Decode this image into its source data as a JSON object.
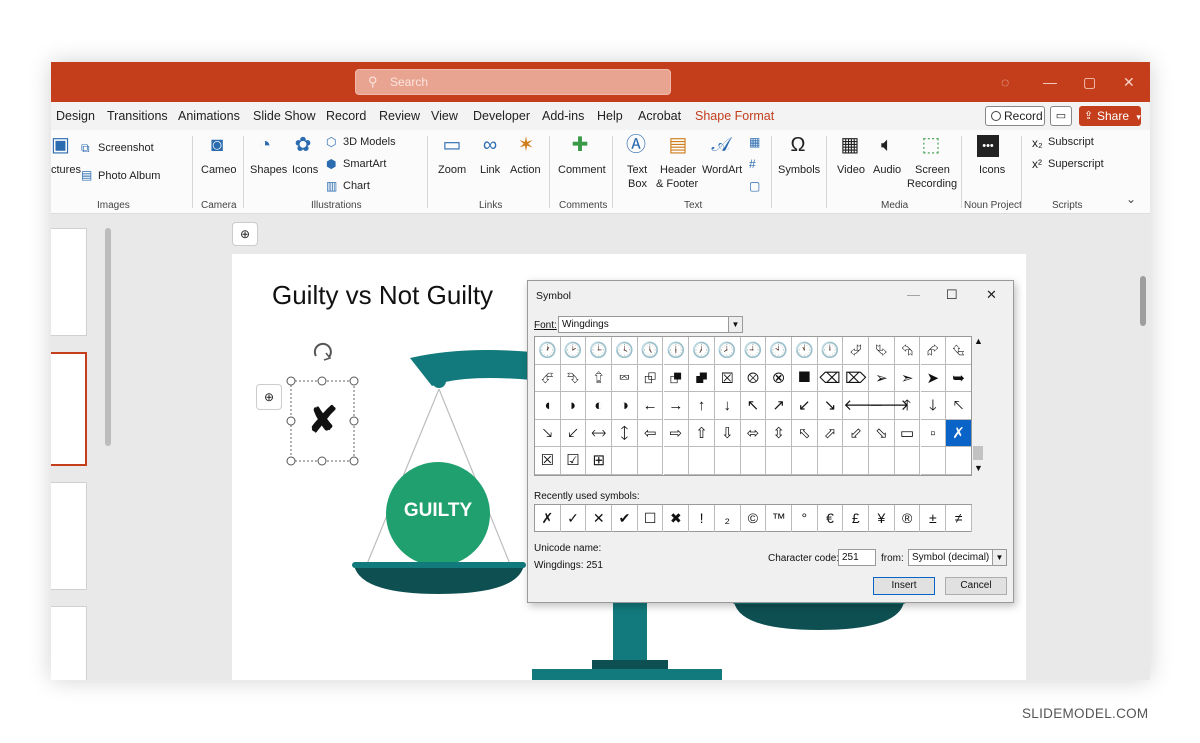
{
  "titlebar": {
    "search_placeholder": "Search"
  },
  "tabs": [
    {
      "label": "Design"
    },
    {
      "label": "Transitions"
    },
    {
      "label": "Animations"
    },
    {
      "label": "Slide Show"
    },
    {
      "label": "Record"
    },
    {
      "label": "Review"
    },
    {
      "label": "View"
    },
    {
      "label": "Developer"
    },
    {
      "label": "Add-ins"
    },
    {
      "label": "Help"
    },
    {
      "label": "Acrobat"
    },
    {
      "label": "Shape Format"
    }
  ],
  "tab_buttons": {
    "record": "Record",
    "share": "Share"
  },
  "ribbon": {
    "images": {
      "pictures": "ctures",
      "screenshot": "Screenshot",
      "photo_album": "Photo Album",
      "label": "Images"
    },
    "camera": {
      "cameo": "Cameo",
      "label": "Camera"
    },
    "illustrations": {
      "shapes": "Shapes",
      "icons": "Icons",
      "models3d": "3D Models",
      "smartart": "SmartArt",
      "chart": "Chart",
      "label": "Illustrations"
    },
    "links": {
      "zoom": "Zoom",
      "link": "Link",
      "action": "Action",
      "label": "Links"
    },
    "comments": {
      "comment": "Comment",
      "label": "Comments"
    },
    "text": {
      "textbox1": "Text",
      "textbox2": "Box",
      "header1": "Header",
      "header2": "& Footer",
      "wordart": "WordArt",
      "label": "Text"
    },
    "symbols": {
      "symbols": "Symbols"
    },
    "media": {
      "video": "Video",
      "audio": "Audio",
      "screen1": "Screen",
      "screen2": "Recording",
      "label": "Media"
    },
    "noun": {
      "icons": "Icons",
      "label": "Noun Project"
    },
    "scripts": {
      "subscript": "Subscript",
      "superscript": "Superscript",
      "label": "Scripts"
    }
  },
  "slide": {
    "title": "Guilty vs Not Guilty",
    "guilty_label": "GUILTY",
    "selected_glyph": "✘"
  },
  "dialog": {
    "title": "Symbol",
    "font_label": "Font:",
    "font_value": "Wingdings",
    "grid_rows": [
      [
        "🕐",
        "🕑",
        "🕒",
        "🕓",
        "🕔",
        "🕕",
        "🕖",
        "🕗",
        "🕘",
        "🕙",
        "🕚",
        "🕛",
        "⮰",
        "⮱",
        "⮲",
        "⮳",
        "⮴",
        "⮵"
      ],
      [
        "⮶",
        "⮷",
        "⮸",
        "⮹",
        "⮺",
        "⮻",
        "⮼",
        "⮽",
        "⮾",
        "⮿",
        "⯀",
        "⌫",
        "⌦",
        "➢",
        "➣",
        "➤",
        "➥",
        "➦"
      ],
      [
        "◖",
        "◗",
        "◐",
        "◑",
        "←",
        "→",
        "↑",
        "↓",
        "↖",
        "↗",
        "↙",
        "↘",
        "🡐",
        "🡒",
        "🡑",
        "🡓",
        "🡔",
        "🡕"
      ],
      [
        "🡖",
        "🡗",
        "🡘",
        "🡙",
        "⇦",
        "⇨",
        "⇧",
        "⇩",
        "⬄",
        "⇳",
        "⬁",
        "⬀",
        "⬃",
        "⬂",
        "▭",
        "▫",
        "✗",
        "✓"
      ],
      [
        "☒",
        "☑",
        "⊞"
      ]
    ],
    "selected_row": 3,
    "selected_col": 16,
    "recent_label": "Recently used symbols:",
    "recent": [
      "✗",
      "✓",
      "✕",
      "✔",
      "☐",
      "✖",
      "!",
      "₂",
      "©",
      "™",
      "°",
      "€",
      "£",
      "¥",
      "®",
      "±",
      "≠"
    ],
    "unicode_name_label": "Unicode name:",
    "unicode_name_value": "Wingdings: 251",
    "char_code_label": "Character code:",
    "char_code_value": "251",
    "from_label": "from:",
    "from_value": "Symbol (decimal)",
    "insert": "Insert",
    "cancel": "Cancel"
  },
  "watermark": "SLIDEMODEL.COM",
  "colors": {
    "accent": "#c43e1c",
    "teal": "#127a7c",
    "green": "#1fa06e",
    "select_blue": "#0a64c8"
  }
}
